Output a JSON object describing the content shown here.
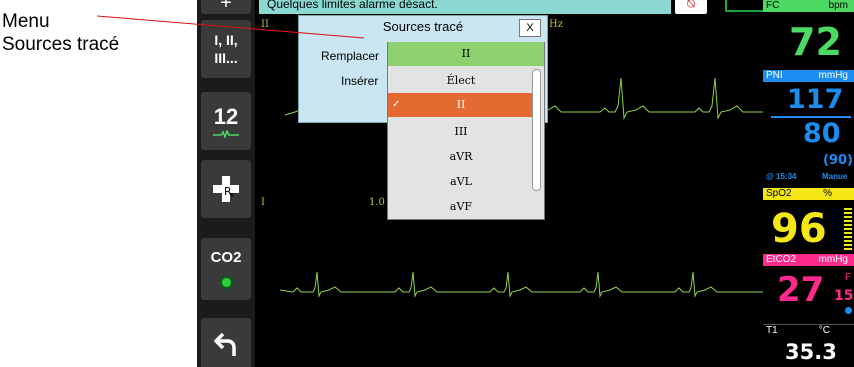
{
  "annotation": {
    "line1": "Menu",
    "line2": "Sources tracé"
  },
  "sidebar": {
    "plus": "+",
    "leads_line1": "I, II,",
    "leads_line2": "III...",
    "twelve": "12",
    "co2": "CO2"
  },
  "alarm_bar": {
    "text": "Quelques limites alarme désact."
  },
  "dialog": {
    "title": "Sources tracé",
    "close": "X",
    "replace_label": "Remplacer",
    "insert_label": "Insérer",
    "replace_value": "II"
  },
  "dropdown": {
    "items": [
      "Élect",
      "II",
      "III",
      "aVR",
      "aVL",
      "aVF"
    ],
    "selected": "II",
    "check": "✓"
  },
  "waveform": {
    "lead_ii": "II",
    "hz": "Hz",
    "lead_i": "I",
    "gain": "1.0"
  },
  "vitals": {
    "fc_label": "FC",
    "fc_unit": "bpm",
    "fc_value": "72",
    "pni_label": "PNI",
    "pni_unit": "mmHg",
    "pni_sys": "117",
    "pni_dia": "80",
    "pni_mean": "(90)",
    "pni_time": "@ 15:34",
    "pni_mode": "Manue",
    "spo2_label": "SpO2",
    "spo2_unit": "%",
    "spo2_value": "96",
    "etco2_label": "EtCO2",
    "etco2_unit": "mmHg",
    "etco2_value": "27",
    "etco2_rr_label": "F",
    "etco2_rr": "15",
    "t1_label": "T1",
    "t1_unit": "°C",
    "t1_value": "35.3"
  },
  "colors": {
    "fc": "#4cd964",
    "pni": "#1d8cf0",
    "spo2": "#f5e616",
    "etco2": "#ff2a8a",
    "t1": "#ffffff",
    "ecg": "#8fd44a",
    "highlight": "#e56a32"
  }
}
